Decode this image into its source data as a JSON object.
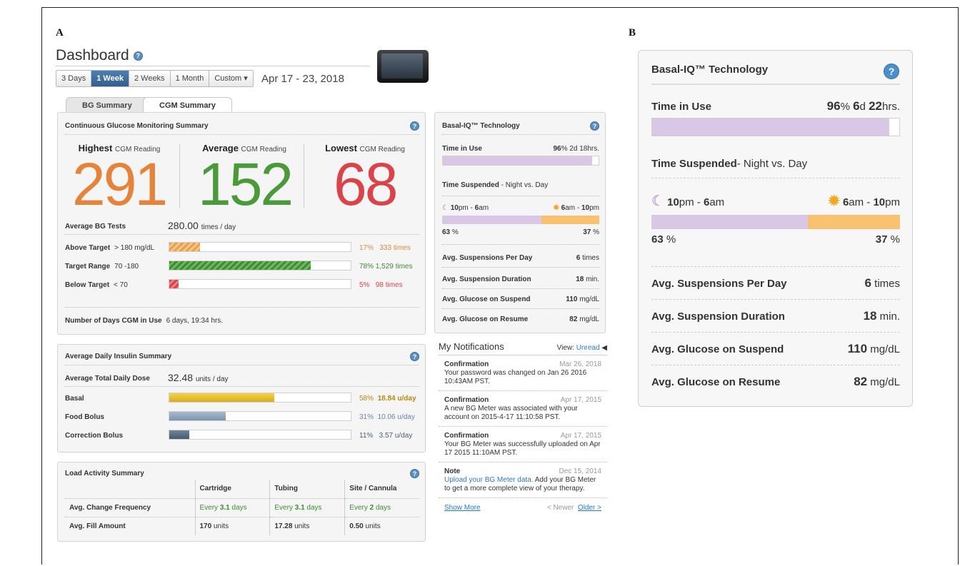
{
  "panels": {
    "a": "A",
    "b": "B"
  },
  "header": {
    "title": "Dashboard",
    "range_buttons": [
      {
        "label": "3 Days",
        "active": false
      },
      {
        "label": "1 Week",
        "active": true
      },
      {
        "label": "2 Weeks",
        "active": false
      },
      {
        "label": "1 Month",
        "active": false
      },
      {
        "label": "Custom ▾",
        "active": false
      }
    ],
    "date_range": "Apr 17 - 23, 2018"
  },
  "tabs": {
    "bg": "BG Summary",
    "cgm": "CGM Summary"
  },
  "cgm": {
    "title": "Continuous Glucose Monitoring Summary",
    "highest_label": "Highest",
    "average_label": "Average",
    "lowest_label": "Lowest",
    "reading_label": "CGM Reading",
    "highest": "291",
    "average": "152",
    "lowest": "68",
    "avg_bg_label": "Average BG Tests",
    "avg_bg_value": "280.00",
    "avg_bg_unit": "times / day",
    "rows": [
      {
        "label": "Above Target",
        "range": "> 180 mg/dL",
        "fraction": 0.17,
        "pct": "17",
        "times": "333 times"
      },
      {
        "label": "Target Range",
        "range": "70 -180",
        "fraction": 0.78,
        "pct": "78",
        "times": "1,529 times"
      },
      {
        "label": "Below Target",
        "range": "< 70",
        "fraction": 0.05,
        "pct": "5",
        "times": "98 times"
      }
    ],
    "days_label": "Number of Days CGM in Use",
    "days_value": "6 days, 19:34 hrs."
  },
  "insulin": {
    "title": "Average Daily Insulin Summary",
    "tdd_label": "Average Total Daily Dose",
    "tdd_value": "32.48",
    "tdd_unit": "units / day",
    "rows": [
      {
        "label": "Basal",
        "fraction": 0.58,
        "pct": "58",
        "amount": "18.84 u/day"
      },
      {
        "label": "Food Bolus",
        "fraction": 0.31,
        "pct": "31",
        "amount": "10.06 u/day"
      },
      {
        "label": "Correction Bolus",
        "fraction": 0.11,
        "pct": "11",
        "amount": "3.57 u/day"
      }
    ]
  },
  "load": {
    "title": "Load Activity Summary",
    "columns": [
      "Cartridge",
      "Tubing",
      "Site / Cannula"
    ],
    "freq_label": "Avg. Change Frequency",
    "freq": [
      {
        "pre": "Every",
        "val": "3.1",
        "post": "days"
      },
      {
        "pre": "Every",
        "val": "3.1",
        "post": "days"
      },
      {
        "pre": "Every",
        "val": "2",
        "post": "days"
      }
    ],
    "fill_label": "Avg. Fill Amount",
    "fill": [
      {
        "val": "170",
        "unit": "units"
      },
      {
        "val": "17.28",
        "unit": "units"
      },
      {
        "val": "0.50",
        "unit": "units"
      }
    ]
  },
  "basal_iq": {
    "title": "Basal-IQ™ Technology",
    "time_in_use_label": "Time in Use",
    "time_in_use_pct": "96",
    "time_in_use_fraction": 0.96,
    "small_d": "2d",
    "small_hrs": "18",
    "large_d": "6",
    "large_hrs": "22",
    "suspended_label": "Time Suspended",
    "suspended_sub": "- Night vs. Day",
    "suspended_sub_small": " - Night vs. Day",
    "night_a": "10",
    "night_b": "6",
    "day_a": "6",
    "day_b": "10",
    "night_pct": "63",
    "night_fraction": 0.63,
    "day_pct": "37",
    "stats": [
      {
        "label": "Avg. Suspensions Per Day",
        "value": "6",
        "unit": "times"
      },
      {
        "label": "Avg. Suspension Duration",
        "value": "18",
        "unit": "min."
      },
      {
        "label": "Avg. Glucose on Suspend",
        "value": "110",
        "unit": "mg/dL"
      },
      {
        "label": "Avg. Glucose on Resume",
        "value": "82",
        "unit": "mg/dL"
      }
    ]
  },
  "notifications": {
    "title": "My Notifications",
    "view_label": "View:",
    "view_value": "Unread",
    "items": [
      {
        "type": "Confirmation",
        "date": "Mar 26, 2018",
        "text": "Your password was changed on Jan 26 2016 10:43AM PST."
      },
      {
        "type": "Confirmation",
        "date": "Apr 17, 2015",
        "text": "A new BG Meter was associated with your account on 2015-4-17 11:10:58 PST."
      },
      {
        "type": "Confirmation",
        "date": "Apr 17, 2015",
        "text": "Your BG Meter was successfully uploaded on Apr 17 2015 11:10AM PST."
      }
    ],
    "note": {
      "type": "Note",
      "date": "Dec 15, 2014",
      "link": "Upload your BG Meter data.",
      "text": " Add your BG Meter to get a more complete view of your therapy."
    },
    "show_more": "Show More",
    "newer": "< Newer",
    "older": "Older >"
  },
  "colors": {
    "above": "#e8a04a",
    "target": "#4a9a3a",
    "below": "#d9434a",
    "basal": "#e8c030",
    "bolus": "#8aa0b8",
    "purple": "#d8c8e6",
    "orange": "#f9c270"
  }
}
